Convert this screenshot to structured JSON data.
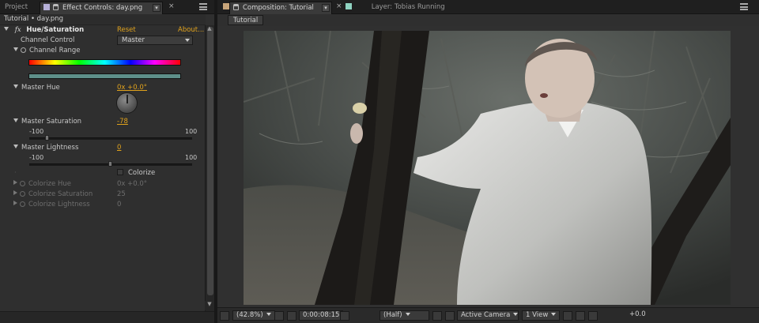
{
  "effect_panel": {
    "tabs": {
      "project": "Project",
      "effect_controls": "Effect Controls: day.png"
    },
    "breadcrumb": "Tutorial • day.png",
    "effect": {
      "name": "Hue/Saturation",
      "fx_icon": "fx",
      "reset": "Reset",
      "about": "About...",
      "channel_control_label": "Channel Control",
      "channel_control_value": "Master",
      "channel_range_label": "Channel Range",
      "master_hue": {
        "label": "Master Hue",
        "value": "0x +0.0°"
      },
      "master_saturation": {
        "label": "Master Saturation",
        "value": "-78",
        "min": "-100",
        "max": "100",
        "level": -78
      },
      "master_lightness": {
        "label": "Master Lightness",
        "value": "0",
        "min": "-100",
        "max": "100",
        "level": 0
      },
      "colorize_label": "Colorize",
      "colorize_hue": {
        "label": "Colorize Hue",
        "value": "0x +0.0°"
      },
      "colorize_saturation": {
        "label": "Colorize Saturation",
        "value": "25"
      },
      "colorize_lightness": {
        "label": "Colorize Lightness",
        "value": "0"
      }
    }
  },
  "viewer_panel": {
    "tabs": {
      "composition": "Composition: Tutorial",
      "layer": "Layer: Tobias Running"
    },
    "view_tab": "Tutorial",
    "status": {
      "zoom": "(42.8%)",
      "timecode": "0:00:08:15",
      "resolution": "(Half)",
      "camera": "Active Camera",
      "views": "1 View",
      "exposure": "+0.0"
    }
  },
  "colors": {
    "accent_orange": "#e0a21c",
    "panel_bg": "#2f2f2f",
    "comp_swatch": "#c8a57a",
    "layer_swatch": "#8fd3c1",
    "effect_swatch": "#b7b1d9"
  }
}
